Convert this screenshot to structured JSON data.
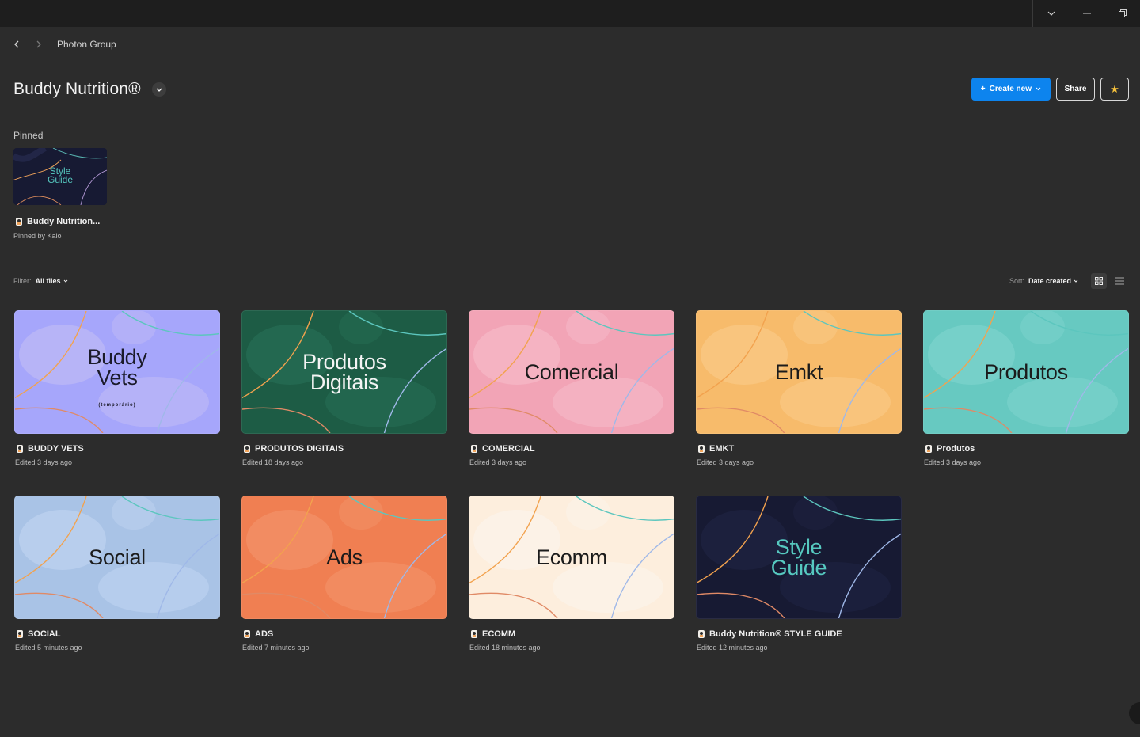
{
  "window": {
    "controls": [
      "chevron-down-icon",
      "minimize-icon",
      "restore-icon"
    ]
  },
  "breadcrumb": {
    "team": "Photon Group"
  },
  "header": {
    "title": "Buddy Nutrition®",
    "create_label": "Create new",
    "share_label": "Share"
  },
  "pinned": {
    "label": "Pinned",
    "item": {
      "thumb_line1": "Style",
      "thumb_line2": "Guide",
      "name": "Buddy Nutrition...",
      "meta": "Pinned by Kaio"
    }
  },
  "toolbar": {
    "filter_label": "Filter:",
    "filter_value": "All files",
    "sort_label": "Sort:",
    "sort_value": "Date created"
  },
  "files": [
    {
      "title_line1": "Buddy",
      "title_line2": "Vets",
      "subtitle": "(temporário)",
      "name": "BUDDY VETS",
      "meta": "Edited 3 days ago",
      "bg": "#a6a6fb",
      "blob": "#bcb8f6",
      "text_color": "#1b1b2a"
    },
    {
      "title_line1": "Produtos",
      "title_line2": "Digitais",
      "subtitle": "",
      "name": "PRODUTOS DIGITAIS",
      "meta": "Edited 18 days ago",
      "bg": "#1d5c45",
      "blob": "#256b52",
      "text_color": "#f4f4f4"
    },
    {
      "title_line1": "Comercial",
      "title_line2": "",
      "subtitle": "",
      "name": "COMERCIAL",
      "meta": "Edited 3 days ago",
      "bg": "#f2a4b6",
      "blob": "#f5b7c6",
      "text_color": "#1b1b1b"
    },
    {
      "title_line1": "Emkt",
      "title_line2": "",
      "subtitle": "",
      "name": "EMKT",
      "meta": "Edited 3 days ago",
      "bg": "#f7bb6b",
      "blob": "#f9c883",
      "text_color": "#1b1b1b"
    },
    {
      "title_line1": "Produtos",
      "title_line2": "",
      "subtitle": "",
      "name": "Produtos",
      "meta": "Edited 3 days ago",
      "bg": "#67c9c1",
      "blob": "#7ad2cb",
      "text_color": "#1b1b1b"
    },
    {
      "title_line1": "Social",
      "title_line2": "",
      "subtitle": "",
      "name": "SOCIAL",
      "meta": "Edited 5 minutes ago",
      "bg": "#a9c3e6",
      "blob": "#bcd1ef",
      "text_color": "#1b1b1b"
    },
    {
      "title_line1": "Ads",
      "title_line2": "",
      "subtitle": "",
      "name": "ADS",
      "meta": "Edited 7 minutes ago",
      "bg": "#f07f52",
      "blob": "#f29066",
      "text_color": "#1b1b1b"
    },
    {
      "title_line1": "Ecomm",
      "title_line2": "",
      "subtitle": "",
      "name": "ECOMM",
      "meta": "Edited 18 minutes ago",
      "bg": "#fdeedd",
      "blob": "#fbf3ea",
      "text_color": "#1b1b1b"
    },
    {
      "title_line1": "Style",
      "title_line2": "Guide",
      "subtitle": "",
      "name": "Buddy Nutrition® STYLE GUIDE",
      "meta": "Edited 12 minutes ago",
      "bg": "#171a33",
      "blob": "#1e2240",
      "text_color": "#56c9c0"
    }
  ]
}
